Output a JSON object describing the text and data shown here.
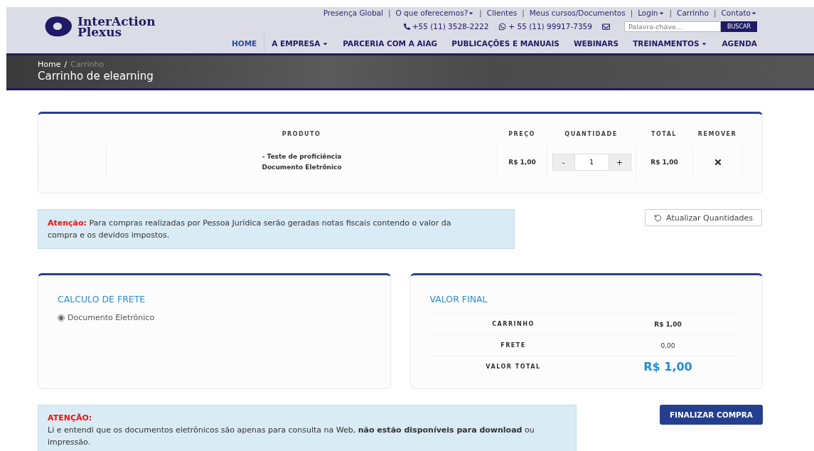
{
  "header": {
    "logo": {
      "line1": "InterAction",
      "line2": "Plexus"
    },
    "top_links": [
      {
        "label": "Presença Global",
        "dropdown": false
      },
      {
        "label": "O que oferecemos?",
        "dropdown": true
      },
      {
        "label": "Clientes",
        "dropdown": false
      },
      {
        "label": "Meus cursos/Documentos",
        "dropdown": false
      },
      {
        "label": "Login",
        "dropdown": true
      },
      {
        "label": "Carrinho",
        "dropdown": false
      },
      {
        "label": "Contato",
        "dropdown": true
      }
    ],
    "contacts": [
      {
        "kind": "phone",
        "label": "+55 (11) 3528-2222"
      },
      {
        "kind": "whatsapp",
        "label": "+ 55 (11) 99917-7359"
      },
      {
        "kind": "mail"
      }
    ],
    "separator": "|",
    "search": {
      "placeholder": "Palavra-chave...",
      "button": "BUSCAR"
    },
    "nav": [
      {
        "label": "HOME",
        "dropdown": false,
        "selected": true
      },
      {
        "label": "A EMPRESA",
        "dropdown": true,
        "selected": false
      },
      {
        "label": "PARCERIA COM A AIAG",
        "dropdown": false,
        "selected": false
      },
      {
        "label": "PUBLICAÇÕES E MANUAIS",
        "dropdown": false,
        "selected": false
      },
      {
        "label": "WEBINARS",
        "dropdown": false,
        "selected": false
      },
      {
        "label": "TREINAMENTOS",
        "dropdown": true,
        "selected": false
      },
      {
        "label": "AGENDA",
        "dropdown": false,
        "selected": false
      }
    ]
  },
  "banner": {
    "breadcrumb": [
      {
        "label": "Home",
        "selected": false
      },
      {
        "label": "Carrinho",
        "selected": true
      }
    ],
    "separator": "/",
    "title": "Carrinho de elearning"
  },
  "cart": {
    "columns": [
      "PRODUTO",
      "PREÇO",
      "QUANTIDADE",
      "TOTAL",
      "REMOVER"
    ],
    "rows": [
      {
        "product": "- Teste de proficiência",
        "type": "Documento Eletrônico",
        "price": "R$ 1,00",
        "minus": "-",
        "quantity": "1",
        "plus": "+",
        "total": "R$ 1,00"
      }
    ]
  },
  "notice": {
    "label": "Atenção:",
    "text": "Para compras realizadas por Pessoa Jurídica serão geradas notas fiscais contendo o valor da compra e os devidos impostos."
  },
  "update_button": "Atualizar Quantidades",
  "shipping": {
    "title": "CALCULO DE FRETE",
    "options": [
      {
        "label": "Documento Eletrônico",
        "selected": true
      }
    ]
  },
  "summary": {
    "title": "VALOR FINAL",
    "rows": [
      {
        "label": "CARRINHO",
        "value": "R$ 1,00",
        "kind": "bold"
      },
      {
        "label": "FRETE",
        "value": "0,00",
        "kind": "plain"
      },
      {
        "label": "VALOR TOTAL",
        "value": "R$ 1,00",
        "kind": "total"
      }
    ]
  },
  "final_notice": {
    "label": "ATENÇÃO:",
    "text": "Li e entendi que os documentos eletrônicos são apenas para consulta na Web, **não estão disponíveis para download** ou impressão."
  },
  "finalize_button": "FINALIZAR COMPRA"
}
